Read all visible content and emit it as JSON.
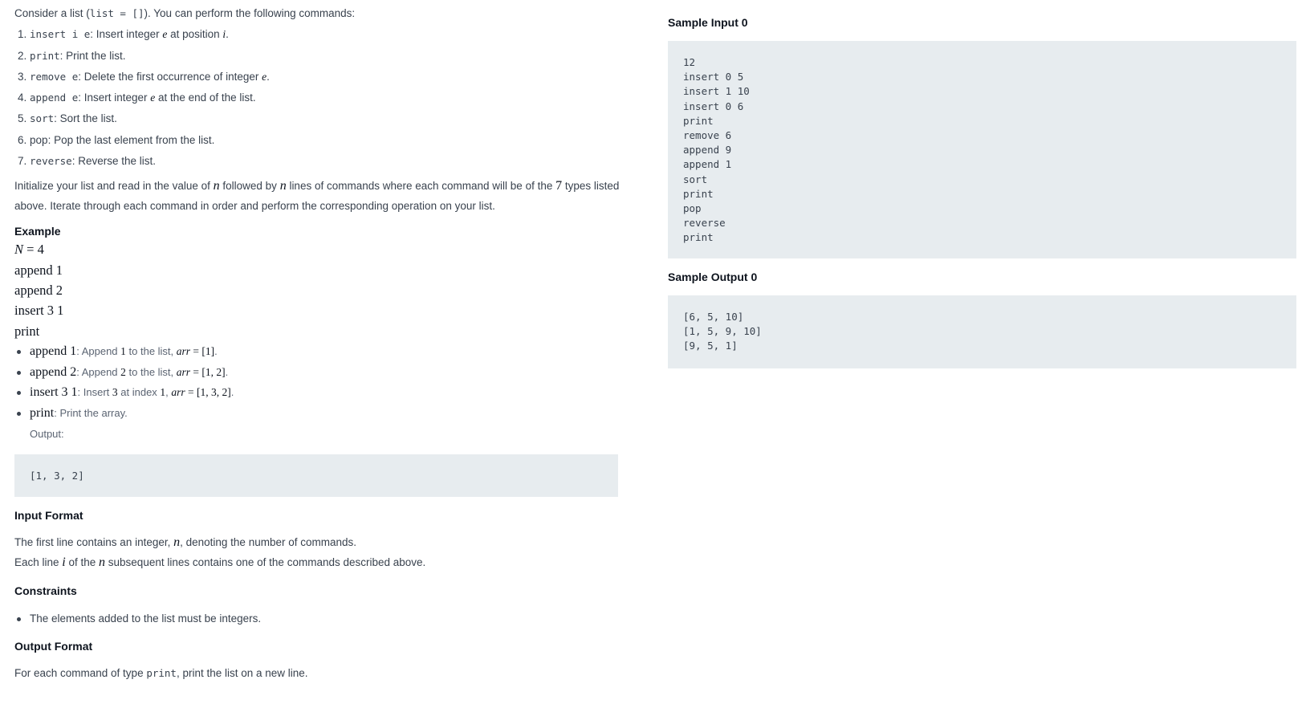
{
  "intro": {
    "before": "Consider a list (",
    "code": "list = []",
    "after": "). You can perform the following commands:"
  },
  "commands": [
    {
      "num": "1.",
      "code": "insert i e",
      "text_a": ": Insert integer ",
      "var_a": "e",
      "text_b": " at position ",
      "var_b": "i",
      "text_c": "."
    },
    {
      "num": "2.",
      "code": "print",
      "text_a": ": Print the list.",
      "var_a": "",
      "text_b": "",
      "var_b": "",
      "text_c": ""
    },
    {
      "num": "3.",
      "code": "remove e",
      "text_a": ": Delete the first occurrence of integer ",
      "var_a": "e",
      "text_b": ".",
      "var_b": "",
      "text_c": ""
    },
    {
      "num": "4.",
      "code": "append e",
      "text_a": ": Insert integer ",
      "var_a": "e",
      "text_b": " at the end of the list.",
      "var_b": "",
      "text_c": ""
    },
    {
      "num": "5.",
      "code": "sort",
      "text_a": ": Sort the list.",
      "var_a": "",
      "text_b": "",
      "var_b": "",
      "text_c": ""
    },
    {
      "num": "6.",
      "code": "pop",
      "text_a": ": Pop the last element from the list.",
      "var_a": "",
      "text_b": "",
      "var_b": "",
      "text_c": ""
    },
    {
      "num": "7.",
      "code": "reverse",
      "text_a": ": Reverse the list.",
      "var_a": "",
      "text_b": "",
      "var_b": "",
      "text_c": ""
    }
  ],
  "init_paragraph": {
    "line1_a": "Initialize your list and read in the value of ",
    "line1_var1": "n",
    "line1_b": " followed by ",
    "line1_var2": "n",
    "line1_c": " lines of commands where each command will be of the ",
    "line1_num": "7",
    "line1_d": " types listed",
    "line2": "above. Iterate through each command in order and perform the corresponding operation on your list."
  },
  "example": {
    "heading": "Example",
    "n_var": "N",
    "n_eq": " = 4",
    "lines": [
      "append 1",
      "append 2",
      "insert 3 1",
      "print"
    ],
    "bullets": [
      {
        "term": "append 1",
        "d1": ": Append ",
        "m1": "1",
        "d2": " to the list, ",
        "var": "arr",
        "m2": " = [1]",
        "d3": "."
      },
      {
        "term": "append 2",
        "d1": ": Append ",
        "m1": "2",
        "d2": " to the list, ",
        "var": "arr",
        "m2": " = [1, 2]",
        "d3": "."
      },
      {
        "term": "insert 3 1",
        "d1": ": Insert ",
        "m1": "3",
        "d2": " at index ",
        "var": "",
        "m2": "1",
        "d3": ", ",
        "var2": "arr",
        "m3": " = [1, 3, 2]",
        "d4": "."
      },
      {
        "term": "print",
        "d1": ": Print the array.",
        "m1": "",
        "d2": "",
        "var": "",
        "m2": "",
        "d3": ""
      }
    ],
    "output_label": "Output:",
    "output_code": "[1, 3, 2]"
  },
  "input_format": {
    "heading": "Input Format",
    "line1_a": "The first line contains an integer, ",
    "line1_var": "n",
    "line1_b": ", denoting the number of commands.",
    "line2_a": "Each line ",
    "line2_var1": "i",
    "line2_b": " of the ",
    "line2_var2": "n",
    "line2_c": " subsequent lines contains one of the commands described above."
  },
  "constraints": {
    "heading": "Constraints",
    "items": [
      "The elements added to the list must be integers."
    ]
  },
  "output_format": {
    "heading": "Output Format",
    "text_a": "For each command of type ",
    "code": "print",
    "text_b": ", print the list on a new line."
  },
  "sample_input": {
    "heading": "Sample Input 0",
    "code": "12\ninsert 0 5\ninsert 1 10\ninsert 0 6\nprint\nremove 6\nappend 9\nappend 1\nsort\nprint\npop\nreverse\nprint"
  },
  "sample_output": {
    "heading": "Sample Output 0",
    "code": "[6, 5, 10]\n[1, 5, 9, 10]\n[9, 5, 1]"
  }
}
